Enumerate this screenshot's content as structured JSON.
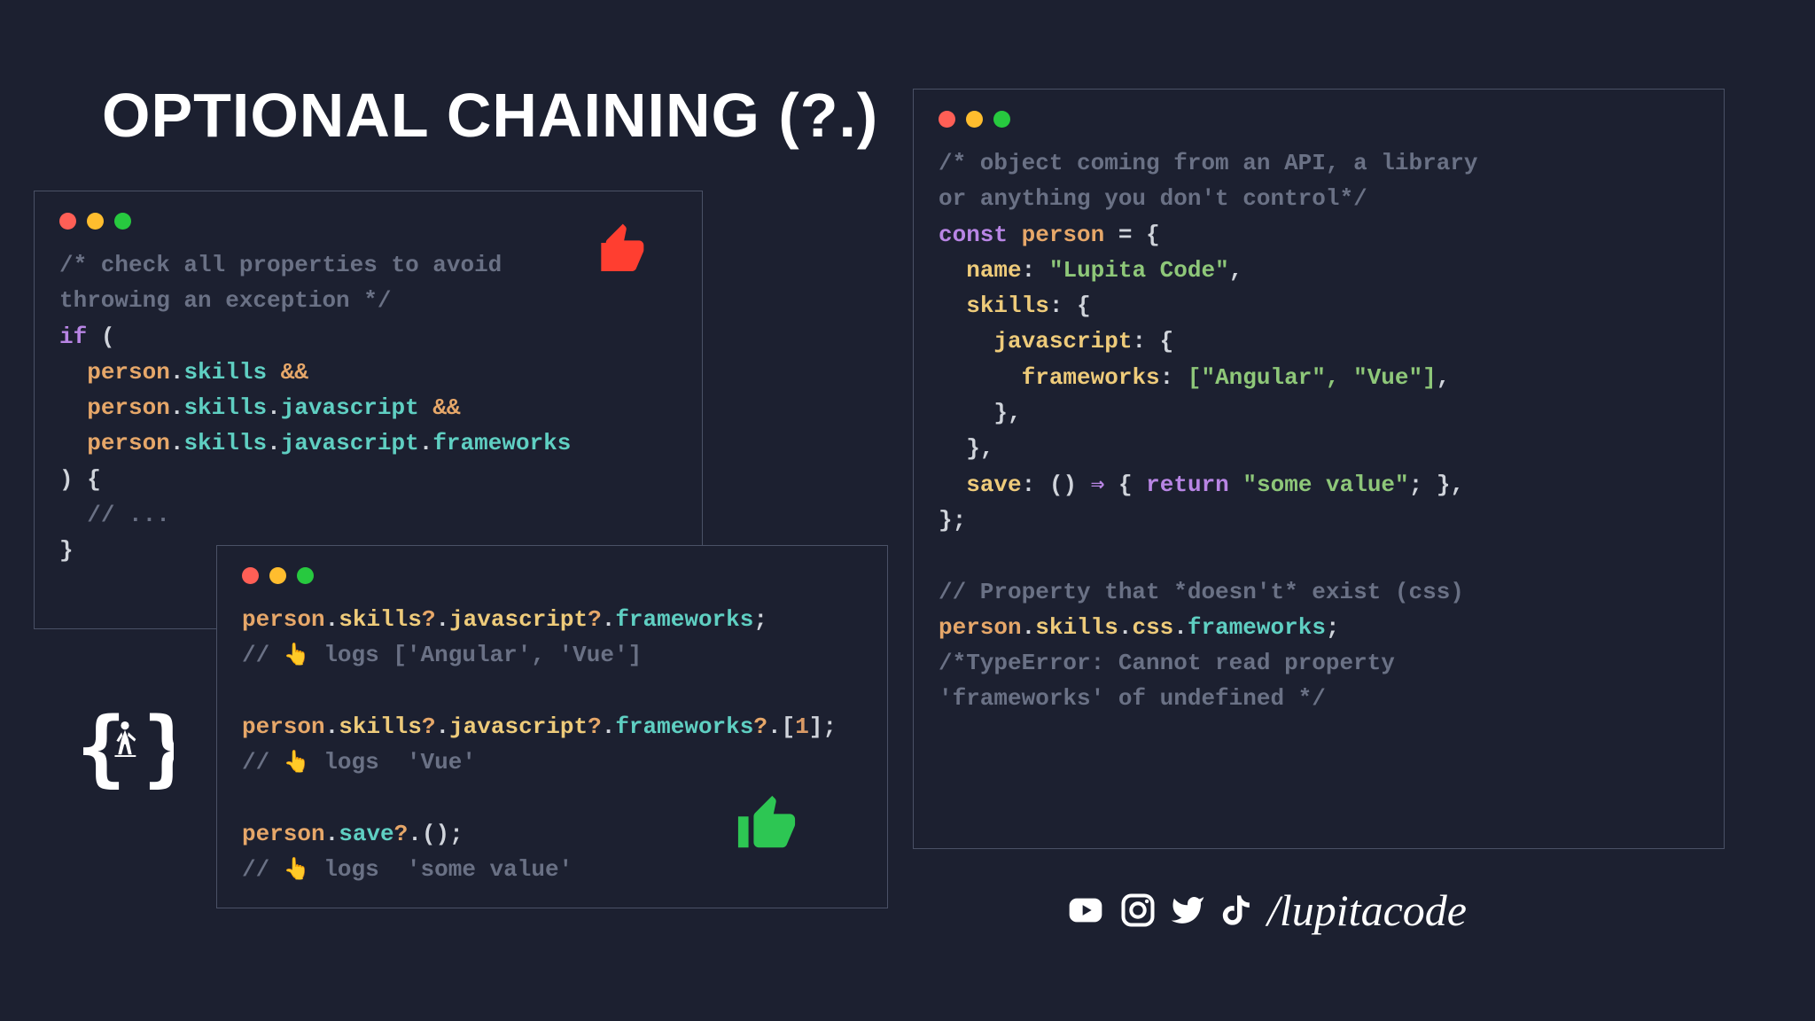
{
  "title": "OPTIONAL CHAINING (?.)",
  "window1": {
    "comment": "/* check all properties to avoid\nthrowing an exception */",
    "kw_if": "if",
    "person": "person",
    "skills": "skills",
    "javascript": "javascript",
    "frameworks": "frameworks",
    "and": "&&",
    "dots": "// ..."
  },
  "window2": {
    "person": "person",
    "skills": "skills",
    "javascript": "javascript",
    "frameworks": "frameworks",
    "save": "save",
    "idx": "1",
    "log1": "logs ['Angular', 'Vue']",
    "log2": "logs  'Vue'",
    "log3": "logs  'some value'"
  },
  "window3": {
    "comment1": "/* object coming from an API, a library\nor anything you don't control*/",
    "const": "const",
    "person": "person",
    "name": "name",
    "name_val": "\"Lupita Code\"",
    "skills": "skills",
    "javascript": "javascript",
    "frameworks": "frameworks",
    "arr": "[\"Angular\", \"Vue\"]",
    "save": "save",
    "return": "return",
    "ret_val": "\"some value\"",
    "comment2": "// Property that *doesn't* exist (css)",
    "css": "css",
    "comment3": "/*TypeError: Cannot read property\n'frameworks' of undefined */"
  },
  "handle": "/lupitacode"
}
